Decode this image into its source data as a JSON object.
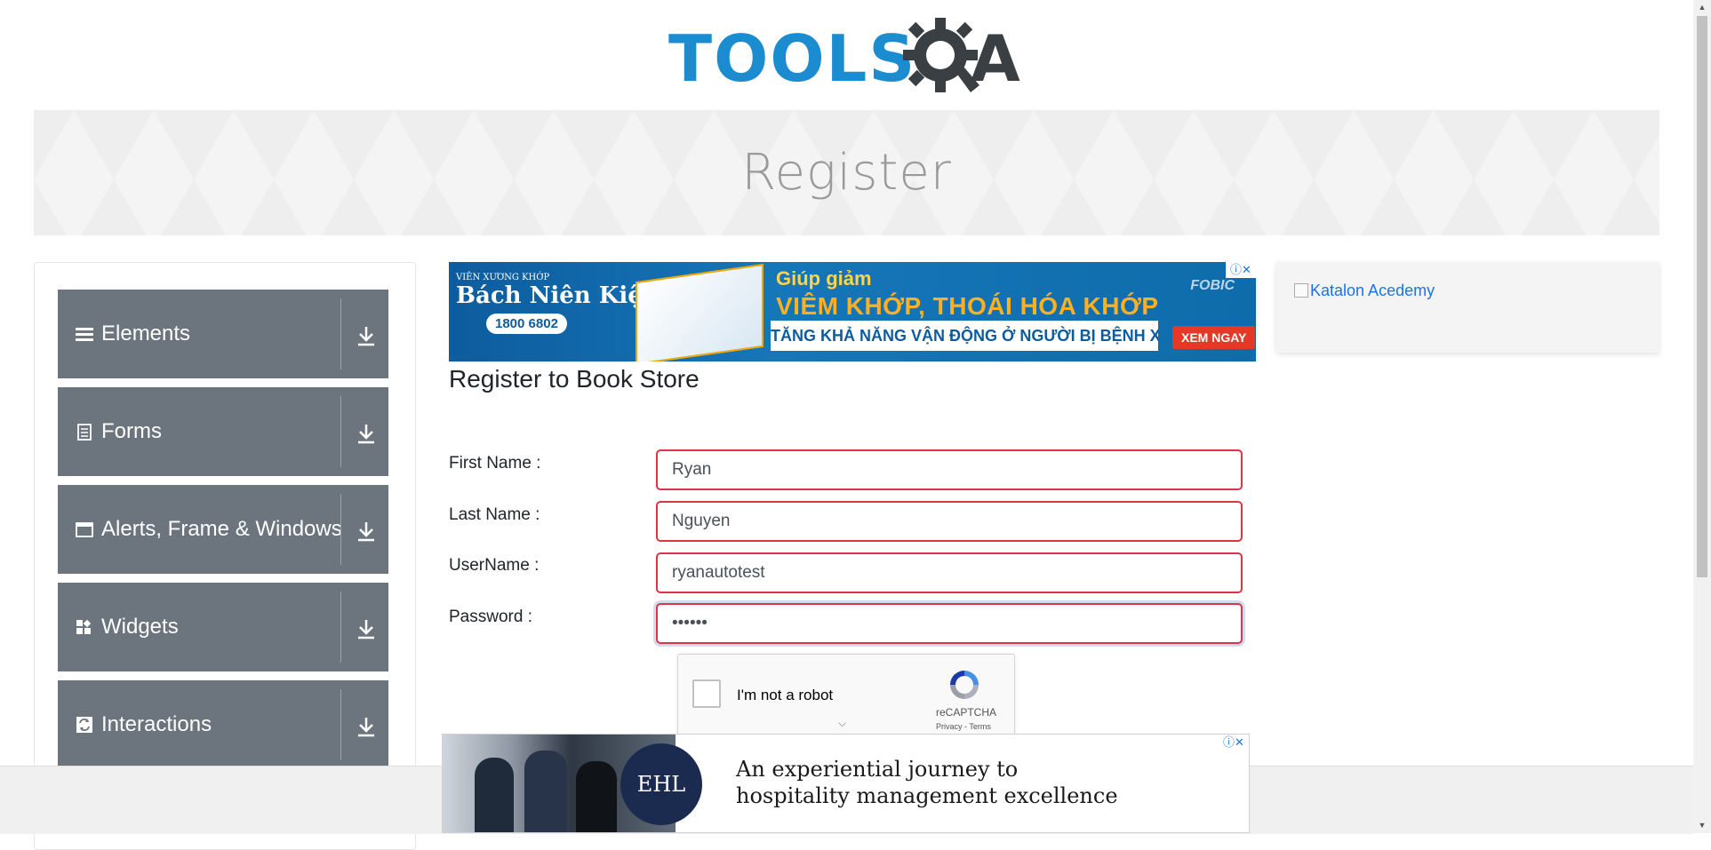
{
  "header": {
    "logo_main": "TOOLS",
    "logo_accent": "A"
  },
  "banner": {
    "title": "Register"
  },
  "sidebar": {
    "items": [
      {
        "label": "Elements",
        "icon": "hamburger-icon"
      },
      {
        "label": "Forms",
        "icon": "document-icon"
      },
      {
        "label": "Alerts, Frame & Windows",
        "icon": "window-icon"
      },
      {
        "label": "Widgets",
        "icon": "widgets-icon"
      },
      {
        "label": "Interactions",
        "icon": "interactions-icon"
      }
    ]
  },
  "ad_top": {
    "brand_small": "VIÊN XƯƠNG KHỚP",
    "brand": "Bách Niên Kiện",
    "phone": "1800 6802",
    "headline_1": "Giúp giảm",
    "headline_2": "VIÊM KHỚP, THOÁI HÓA KHỚP",
    "headline_3": "TĂNG KHẢ NĂNG VẬN ĐỘNG Ở NGƯỜI BỊ BỆNH XƯƠNG KHỚP",
    "cta": "XEM NGAY",
    "sponsor": "FOBIC"
  },
  "ad_right": {
    "alt_text": "Katalon Acedemy"
  },
  "form": {
    "title": "Register to Book Store",
    "fields": [
      {
        "label": "First Name :",
        "value": "Ryan"
      },
      {
        "label": "Last Name :",
        "value": "Nguyen"
      },
      {
        "label": "UserName :",
        "value": "ryanautotest"
      },
      {
        "label": "Password :",
        "value": "••••••"
      }
    ]
  },
  "recaptcha": {
    "label": "I'm not a robot",
    "brand": "reCAPTCHA",
    "terms": "Privacy - Terms"
  },
  "ad_bottom": {
    "logo": "EHL",
    "line_1": "An experiential journey to",
    "line_2": "hospitality management excellence"
  },
  "colors": {
    "sidebar_item_bg": "#6c757d",
    "invalid_border": "#dc3545",
    "logo_blue": "#1b8ccf"
  }
}
